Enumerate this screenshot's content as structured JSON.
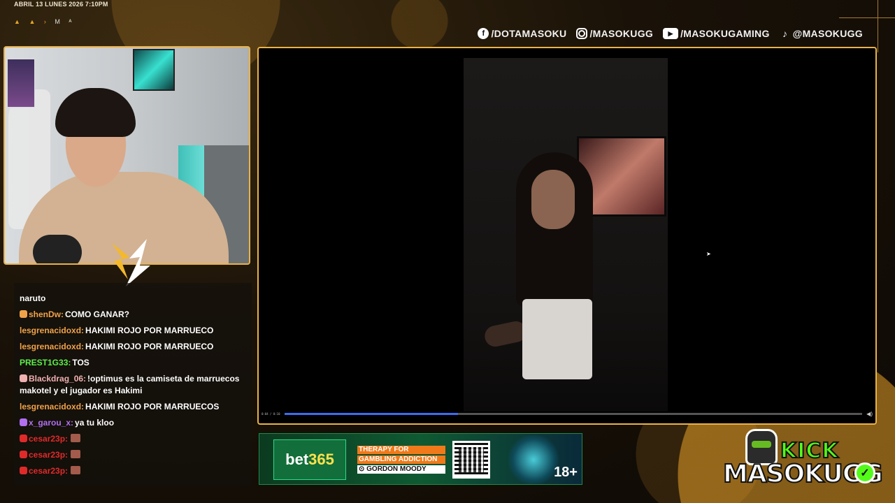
{
  "overlay": {
    "date_time": "ABRIL 13 LUNES 2026 7:10PM",
    "indicators": [
      "▲",
      "▲",
      "›",
      "M",
      "ᴬ"
    ],
    "accent_color": "#e9b24a"
  },
  "socials": [
    {
      "icon": "facebook-icon",
      "text": "/DOTAMASOKU"
    },
    {
      "icon": "instagram-icon",
      "text": "/MASOKUGG"
    },
    {
      "icon": "youtube-icon",
      "text": "/MASOKUGAMING"
    },
    {
      "icon": "tiktok-icon",
      "text": "@MASOKUGG"
    }
  ],
  "chat": {
    "messages": [
      {
        "user": "",
        "text": "naruto",
        "user_color": "#f0a24a"
      },
      {
        "user": "shenDw:",
        "text": "COMO GANAR?",
        "user_color": "#f0a24a"
      },
      {
        "user": "lesgrenacidoxd:",
        "text": "HAKIMI ROJO POR MARRUECO",
        "user_color": "#f0a24a"
      },
      {
        "user": "lesgrenacidoxd:",
        "text": "HAKIMI ROJO POR MARRUECO",
        "user_color": "#f0a24a"
      },
      {
        "user": "PREST1G33:",
        "text": "TOS",
        "user_color": "#5df04a"
      },
      {
        "user": "Blackdrag_06:",
        "text": "!optimus es la camiseta de marruecos makotel y el jugador es Hakimi",
        "user_color": "#f0b0b0"
      },
      {
        "user": "lesgrenacidoxd:",
        "text": "HAKIMI ROJO POR MARRUECOS",
        "user_color": "#f0a24a"
      },
      {
        "user": "x_garou_x:",
        "text": "ya tu kloo",
        "user_color": "#b070f0"
      },
      {
        "user": "cesar23p:",
        "text": "",
        "user_color": "#e02a2a"
      },
      {
        "user": "cesar23p:",
        "text": "",
        "user_color": "#e02a2a"
      },
      {
        "user": "cesar23p:",
        "text": "",
        "user_color": "#e02a2a"
      }
    ]
  },
  "video": {
    "time_label": "0:04 / 0:10",
    "progress_fraction": 0.3
  },
  "ad": {
    "brand_main": "bet",
    "brand_num": "365",
    "line1": "THERAPY FOR",
    "line2": "GAMBLING ADDICTION",
    "line3": "⊙ GORDON MOODY",
    "age": "18+"
  },
  "kick": {
    "word": "KICK",
    "name": "MASOKUGG",
    "check": "✓",
    "brand_color": "#53fc18"
  }
}
